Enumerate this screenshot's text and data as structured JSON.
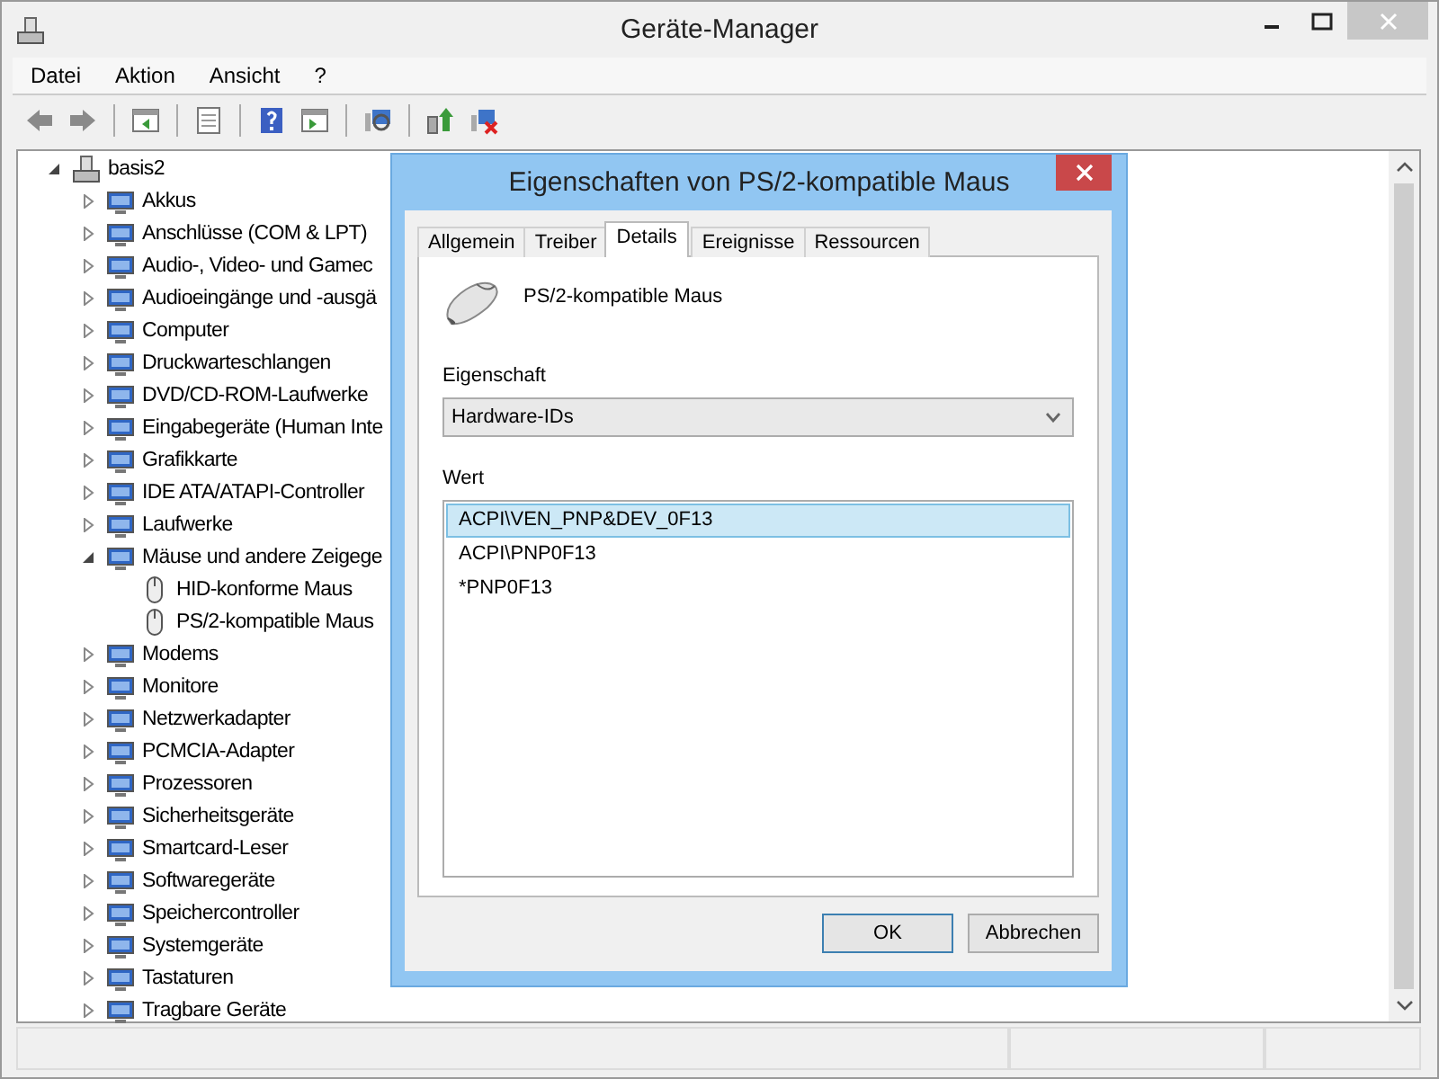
{
  "window": {
    "title": "Geräte-Manager"
  },
  "menu": [
    "Datei",
    "Aktion",
    "Ansicht",
    "?"
  ],
  "tree": {
    "label": "basis2",
    "expanded": true,
    "children": [
      {
        "label": "Akkus",
        "expanded": false
      },
      {
        "label": "Anschlüsse (COM & LPT)",
        "expanded": false
      },
      {
        "label": "Audio-, Video- und Gamec",
        "expanded": false
      },
      {
        "label": "Audioeingänge und -ausgä",
        "expanded": false
      },
      {
        "label": "Computer",
        "expanded": false
      },
      {
        "label": "Druckwarteschlangen",
        "expanded": false
      },
      {
        "label": "DVD/CD-ROM-Laufwerke",
        "expanded": false
      },
      {
        "label": "Eingabegeräte (Human Inte",
        "expanded": false
      },
      {
        "label": "Grafikkarte",
        "expanded": false
      },
      {
        "label": "IDE ATA/ATAPI-Controller",
        "expanded": false
      },
      {
        "label": "Laufwerke",
        "expanded": false
      },
      {
        "label": "Mäuse und andere Zeigege",
        "expanded": true,
        "children": [
          {
            "label": "HID-konforme Maus"
          },
          {
            "label": "PS/2-kompatible Maus"
          }
        ]
      },
      {
        "label": "Modems",
        "expanded": false
      },
      {
        "label": "Monitore",
        "expanded": false
      },
      {
        "label": "Netzwerkadapter",
        "expanded": false
      },
      {
        "label": "PCMCIA-Adapter",
        "expanded": false
      },
      {
        "label": "Prozessoren",
        "expanded": false
      },
      {
        "label": "Sicherheitsgeräte",
        "expanded": false
      },
      {
        "label": "Smartcard-Leser",
        "expanded": false
      },
      {
        "label": "Softwaregeräte",
        "expanded": false
      },
      {
        "label": "Speichercontroller",
        "expanded": false
      },
      {
        "label": "Systemgeräte",
        "expanded": false
      },
      {
        "label": "Tastaturen",
        "expanded": false
      },
      {
        "label": "Tragbare Geräte",
        "expanded": false
      }
    ]
  },
  "dialog": {
    "title": "Eigenschaften von PS/2-kompatible Maus",
    "tabs": [
      {
        "label": "Allgemein",
        "selected": false
      },
      {
        "label": "Treiber",
        "selected": false
      },
      {
        "label": "Details",
        "selected": true
      },
      {
        "label": "Ereignisse",
        "selected": false
      },
      {
        "label": "Ressourcen",
        "selected": false
      }
    ],
    "device_name": "PS/2-kompatible Maus",
    "property_label": "Eigenschaft",
    "property_value": "Hardware-IDs",
    "value_label": "Wert",
    "values": [
      {
        "text": "ACPI\\VEN_PNP&DEV_0F13",
        "selected": true
      },
      {
        "text": "ACPI\\PNP0F13",
        "selected": false
      },
      {
        "text": "*PNP0F13",
        "selected": false
      }
    ],
    "buttons": [
      {
        "label": "OK",
        "default": true
      },
      {
        "label": "Abbrechen",
        "default": false
      }
    ]
  }
}
